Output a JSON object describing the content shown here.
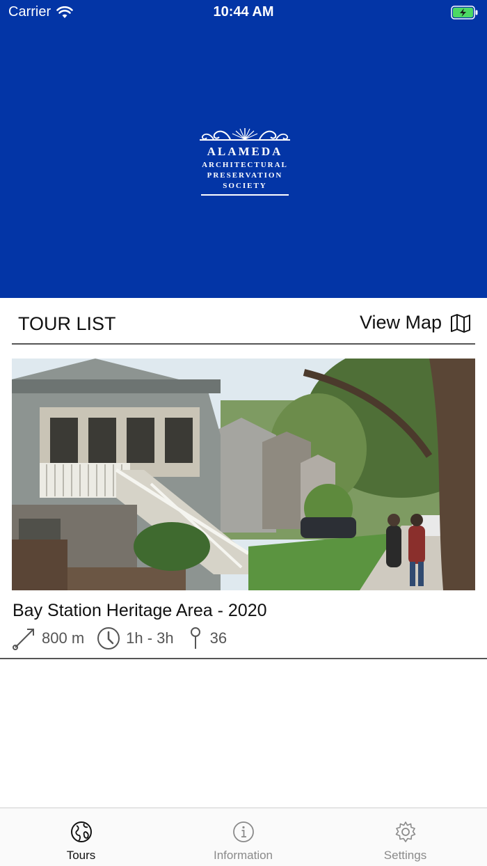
{
  "status_bar": {
    "carrier": "Carrier",
    "time": "10:44 AM"
  },
  "logo": {
    "line1": "ALAMEDA",
    "line2": "ARCHITECTURAL",
    "line3": "PRESERVATION",
    "line4": "SOCIETY"
  },
  "section": {
    "title": "TOUR LIST",
    "view_map_label": "View Map"
  },
  "tours": [
    {
      "name": "Bay Station Heritage Area - 2020",
      "distance": "800 m",
      "duration": "1h - 3h",
      "stops": "36"
    }
  ],
  "tabbar": {
    "items": [
      {
        "label": "Tours",
        "icon": "globe-icon",
        "active": true
      },
      {
        "label": "Information",
        "icon": "info-icon",
        "active": false
      },
      {
        "label": "Settings",
        "icon": "gear-icon",
        "active": false
      }
    ]
  },
  "colors": {
    "brand_blue": "#0335a6",
    "battery_green": "#4cd964"
  }
}
